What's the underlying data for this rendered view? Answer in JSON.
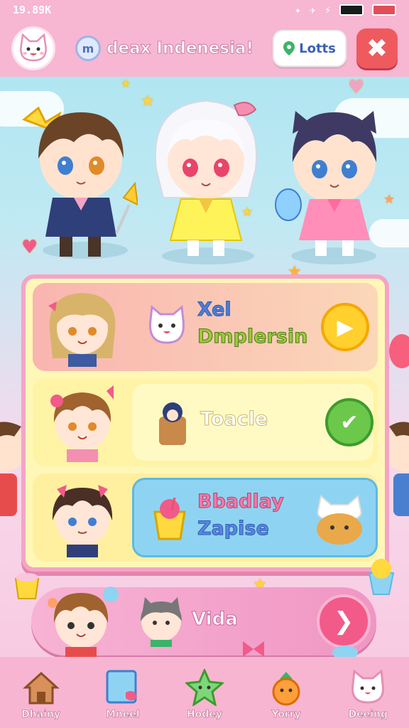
{
  "status": {
    "time": "19.89K"
  },
  "header": {
    "title": "deax Indenesia!",
    "lotts_label": "Lotts",
    "close_icon": "close-icon",
    "globe_glyph": "m"
  },
  "menu": {
    "items": [
      {
        "label_line1": "Xel",
        "label_line2": "Dmplersin",
        "action_icon": "play-icon"
      },
      {
        "label": "Toacle",
        "action_icon": "check-icon"
      },
      {
        "label_line1": "Bbadlay",
        "label_line2": "Zapise",
        "action_icon": "none"
      }
    ]
  },
  "video": {
    "label": "Vida",
    "action_icon": "chevron-right-icon"
  },
  "nav": {
    "items": [
      {
        "label": "Dhainy",
        "icon": "home-icon"
      },
      {
        "label": "Mneel",
        "icon": "note-icon"
      },
      {
        "label": "Hodey",
        "icon": "star-icon"
      },
      {
        "label": "Yorry",
        "icon": "carrot-icon"
      },
      {
        "label": "Deeing",
        "icon": "cat-icon"
      }
    ]
  },
  "colors": {
    "pink": "#f7b6d2",
    "red": "#ef5a5f",
    "yellow": "#fff7b8",
    "blue": "#a8e4f0"
  }
}
